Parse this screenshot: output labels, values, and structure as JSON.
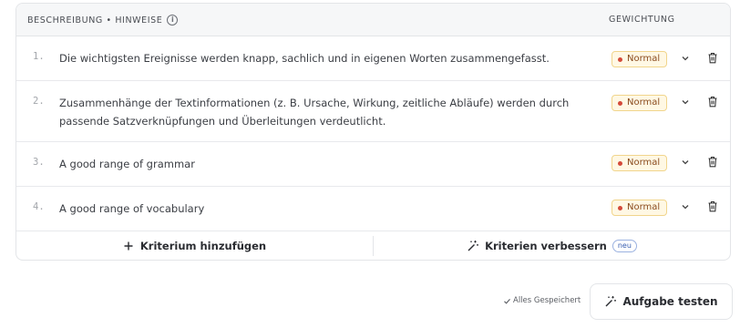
{
  "header": {
    "description_label": "BESCHREIBUNG • HINWEISE",
    "weighting_label": "GEWICHTUNG"
  },
  "criteria": [
    {
      "num": "1.",
      "text": "Die wichtigsten Ereignisse werden knapp, sachlich und in eigenen Worten zusammengefasst.",
      "weight": "Normal"
    },
    {
      "num": "2.",
      "text": "Zusammenhänge der Textinformationen (z. B. Ursache, Wirkung, zeitliche Abläufe) werden durch passende Satzverknüpfungen und Überleitungen verdeutlicht.",
      "weight": "Normal"
    },
    {
      "num": "3.",
      "text": "A good range of grammar",
      "weight": "Normal"
    },
    {
      "num": "4.",
      "text": "A good range of vocabulary",
      "weight": "Normal"
    }
  ],
  "footer": {
    "add_label": "Kriterium hinzufügen",
    "improve_label": "Kriterien verbessern",
    "new_badge": "neu"
  },
  "status": {
    "saved_label": "Alles Gespeichert"
  },
  "actions": {
    "test_label": "Aufgabe testen"
  },
  "colors": {
    "badge_dot": "#d44a3a",
    "badge_bg": "#fff8e4",
    "new_badge": "#3a5fb0"
  }
}
